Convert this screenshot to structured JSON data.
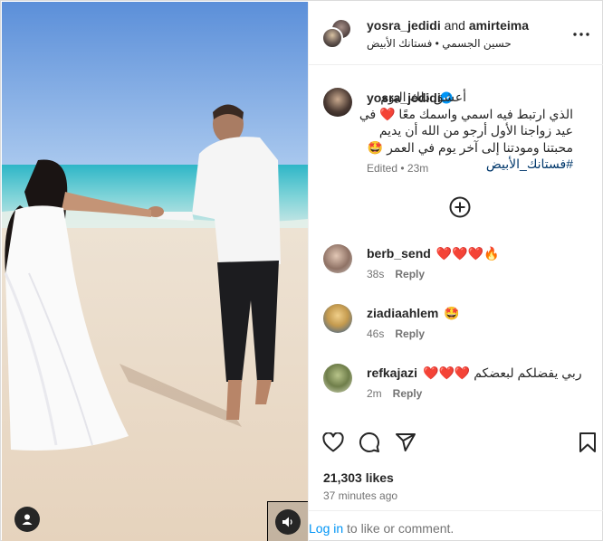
{
  "post": {
    "header": {
      "author_primary": "yosra_jedidi",
      "and_text": " and ",
      "author_secondary": "amirteima",
      "audio": "حسين الجسمي • فستانك الأبيض"
    },
    "caption": {
      "username": "yosra_jedidi",
      "text": "أعشق ذلك اليوم الذي ارتبط فيه اسمي واسمك معًا ❤️ في عيد زواجنا الأول أرجو من الله أن يديم محبتنا ومودتنا إلى آخر يوم في العمر 🤩",
      "hashtag": "#فستانك_الأبيض",
      "edited": "Edited",
      "dot": " • ",
      "time": "23m"
    },
    "comments": [
      {
        "username": "berb_send",
        "text": "❤️❤️❤️🔥",
        "time": "38s",
        "reply": "Reply"
      },
      {
        "username": "ziadiaahlem",
        "text": "🤩",
        "time": "46s",
        "reply": "Reply"
      },
      {
        "username": "refkajazi",
        "text": "ربي يفضلكم لبعضكم ❤️❤️❤️",
        "time": "2m",
        "reply": "Reply"
      }
    ],
    "likes": "21,303 likes",
    "posted_ago": "37 minutes ago",
    "login": {
      "link": "Log in",
      "rest": " to like or comment."
    }
  },
  "icons": {
    "more": "more-options-icon",
    "add": "plus-circle-icon",
    "like": "heart-icon",
    "comment": "comment-icon",
    "share": "share-icon",
    "save": "bookmark-icon",
    "user_tag": "user-tag-icon",
    "audio": "speaker-icon",
    "verified": "verified-badge-icon"
  },
  "colors": {
    "link_blue": "#0095f6",
    "hashtag": "#00376b",
    "verified": "#0095f6",
    "muted": "#737373"
  }
}
